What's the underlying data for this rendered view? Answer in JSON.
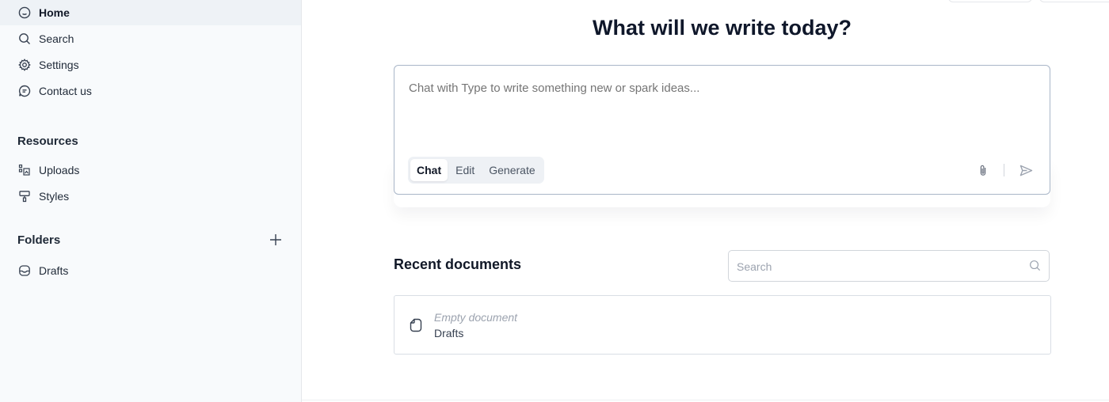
{
  "sidebar": {
    "nav": [
      {
        "label": "Home",
        "icon": "home-icon",
        "active": true
      },
      {
        "label": "Search",
        "icon": "search-icon"
      },
      {
        "label": "Settings",
        "icon": "gear-icon"
      },
      {
        "label": "Contact us",
        "icon": "chat-bubble-icon"
      }
    ],
    "resources_title": "Resources",
    "resources": [
      {
        "label": "Uploads",
        "icon": "uploads-icon"
      },
      {
        "label": "Styles",
        "icon": "paint-roller-icon"
      }
    ],
    "folders_title": "Folders",
    "folders": [
      {
        "label": "Drafts",
        "icon": "folder-inbox-icon"
      }
    ]
  },
  "main": {
    "heading": "What will we write today?",
    "composer": {
      "placeholder": "Chat with Type to write something new or spark ideas...",
      "modes": [
        "Chat",
        "Edit",
        "Generate"
      ],
      "active_mode": "Chat"
    },
    "recent": {
      "title": "Recent documents",
      "search_placeholder": "Search",
      "documents": [
        {
          "title": "Empty document",
          "folder": "Drafts"
        }
      ]
    }
  }
}
